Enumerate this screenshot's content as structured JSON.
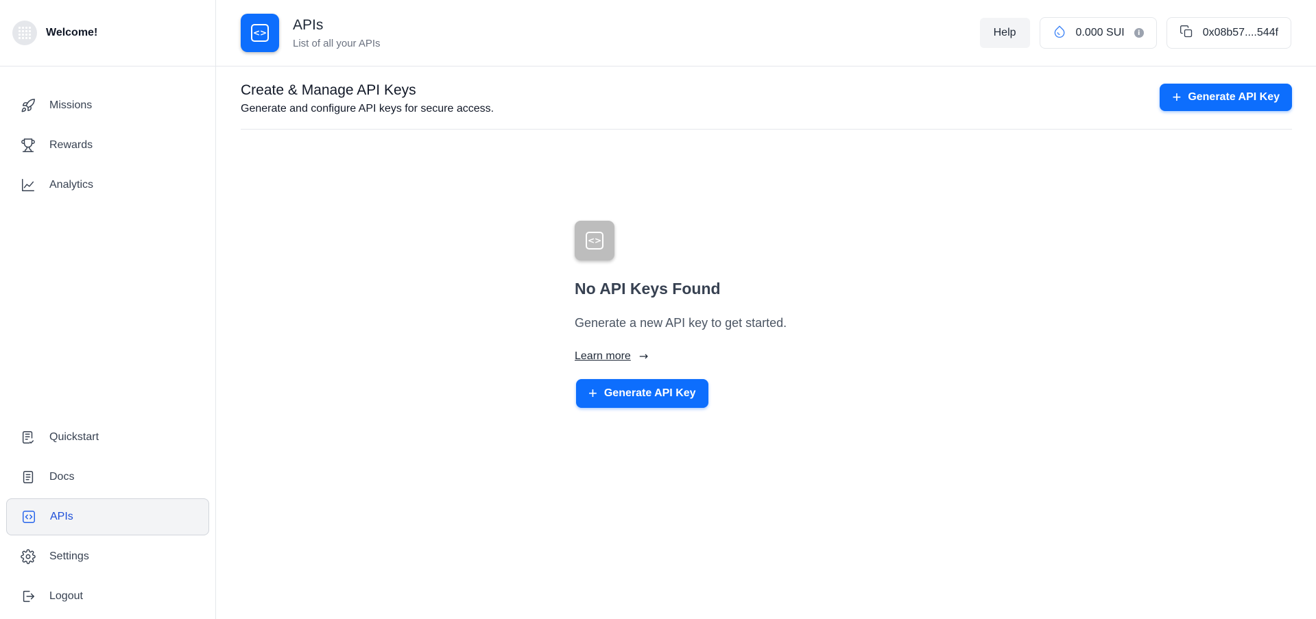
{
  "sidebar": {
    "brand": {
      "title": "Welcome!",
      "icon": "avatar-icon"
    },
    "top_items": [
      {
        "label": "Missions",
        "icon": "rocket-icon"
      },
      {
        "label": "Rewards",
        "icon": "trophy-icon"
      },
      {
        "label": "Analytics",
        "icon": "chart-line-icon"
      }
    ],
    "bottom_items": [
      {
        "label": "Quickstart",
        "icon": "checklist-icon"
      },
      {
        "label": "Docs",
        "icon": "document-icon"
      },
      {
        "label": "APIs",
        "icon": "code-icon",
        "active": true
      },
      {
        "label": "Settings",
        "icon": "gear-icon"
      },
      {
        "label": "Logout",
        "icon": "logout-icon"
      }
    ]
  },
  "header": {
    "title": "APIs",
    "subtitle": "List of all your APIs",
    "help_label": "Help",
    "balance": "0.000 SUI",
    "wallet": "0x08b57....544f"
  },
  "section": {
    "title": "Create & Manage API Keys",
    "subtitle": "Generate and configure API keys for secure access.",
    "button_label": "Generate API Key"
  },
  "empty_state": {
    "title": "No API Keys Found",
    "text": "Generate a new API key to get started.",
    "link": "Learn more",
    "button_label": "Generate API Key"
  },
  "colors": {
    "primary": "#0d6efd",
    "active_nav_bg": "#f3f4f6",
    "border": "#e5e7eb"
  }
}
